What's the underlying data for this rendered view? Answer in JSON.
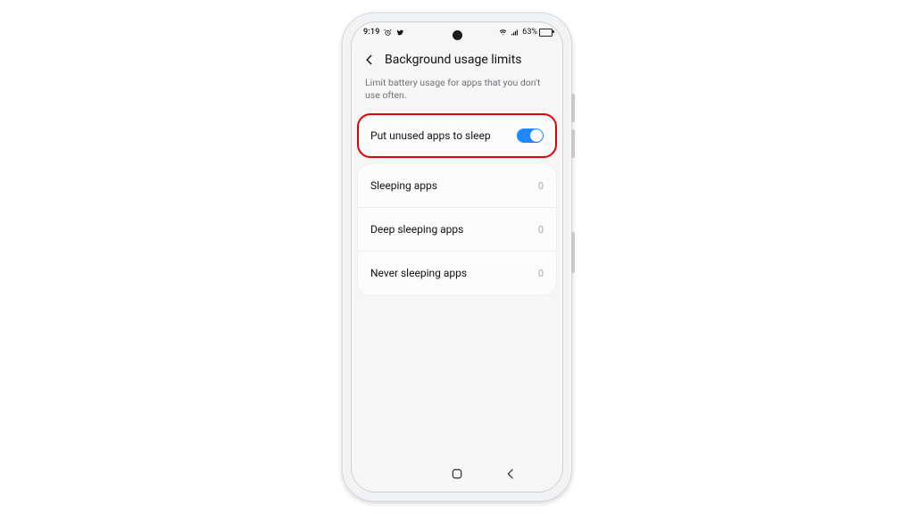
{
  "statusbar": {
    "time": "9:19",
    "battery_pct": "63%",
    "battery_fill_pct": 63
  },
  "header": {
    "title": "Background usage limits",
    "description": "Limit battery usage for apps that you don't use often."
  },
  "toggle_row": {
    "label": "Put unused apps to sleep",
    "on": true
  },
  "list": [
    {
      "label": "Sleeping apps",
      "count": "0"
    },
    {
      "label": "Deep sleeping apps",
      "count": "0"
    },
    {
      "label": "Never sleeping apps",
      "count": "0"
    }
  ],
  "colors": {
    "highlight": "#e60000",
    "switch_on": "#1f87ff"
  }
}
